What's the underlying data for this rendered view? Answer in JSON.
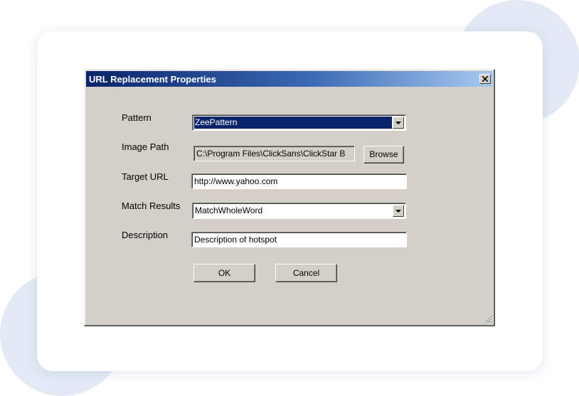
{
  "dialog": {
    "title": "URL Replacement Properties",
    "close_icon": "close-x-icon"
  },
  "form": {
    "pattern": {
      "label": "Pattern",
      "value": "ZeePattern"
    },
    "image_path": {
      "label": "Image Path",
      "value": "C:\\Program Files\\ClickSans\\ClickStar B",
      "browse_label": "Browse"
    },
    "target_url": {
      "label": "Target URL",
      "value": "http://www.yahoo.com"
    },
    "match_results": {
      "label": "Match Results",
      "value": "MatchWholeWord"
    },
    "description": {
      "label": "Description",
      "value": "Description of hotspot"
    }
  },
  "buttons": {
    "ok": "OK",
    "cancel": "Cancel"
  },
  "colors": {
    "titlebar_start": "#0a246a",
    "titlebar_end": "#a6caf0",
    "dialog_face": "#d4d0c8",
    "selection": "#0a246a"
  }
}
